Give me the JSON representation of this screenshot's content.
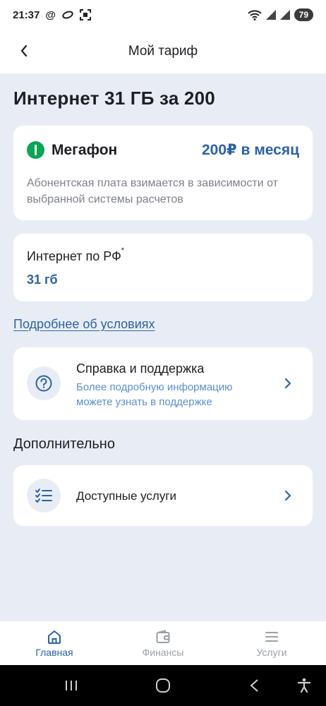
{
  "status_bar": {
    "time": "21:37",
    "battery": "79"
  },
  "header": {
    "title": "Мой тариф"
  },
  "tariff": {
    "name": "Интернет 31 ГБ за 200"
  },
  "operator": {
    "name": "Мегафон",
    "price": "200₽ в месяц",
    "description": "Абонентская плата взимается в зависимости от выбранной системы расчетов"
  },
  "internet": {
    "label": "Интернет по РФ",
    "footnote_mark": "*",
    "value": "31 гб"
  },
  "details_link": "Подробнее об условиях",
  "support": {
    "title": "Справка и поддержка",
    "subtitle": "Более подробную информацию можете узнать в поддержке"
  },
  "additional": {
    "section_title": "Дополнительно",
    "services_label": "Доступные услуги"
  },
  "bottom_nav": {
    "items": [
      {
        "label": "Главная",
        "icon": "home-icon",
        "active": true
      },
      {
        "label": "Финансы",
        "icon": "wallet-icon",
        "active": false
      },
      {
        "label": "Услуги",
        "icon": "menu-icon",
        "active": false
      }
    ]
  },
  "colors": {
    "accent": "#2d62a8",
    "background": "#e8edf5",
    "operator_green": "#0aa656"
  }
}
